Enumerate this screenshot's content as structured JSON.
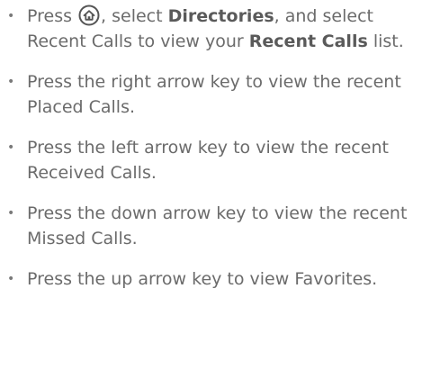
{
  "instructions": [
    {
      "parts": [
        {
          "type": "text",
          "text": "Press "
        },
        {
          "type": "icon",
          "icon": "home-icon"
        },
        {
          "type": "text",
          "text": ", select "
        },
        {
          "type": "bold",
          "text": "Directories"
        },
        {
          "type": "text",
          "text": ", and select Recent Calls to view your "
        },
        {
          "type": "bold",
          "text": "Recent Calls"
        },
        {
          "type": "text",
          "text": " list."
        }
      ]
    },
    {
      "parts": [
        {
          "type": "text",
          "text": "Press the right arrow key to view the recent Placed Calls."
        }
      ]
    },
    {
      "parts": [
        {
          "type": "text",
          "text": "Press the left arrow key to view the recent Received Calls."
        }
      ]
    },
    {
      "parts": [
        {
          "type": "text",
          "text": "Press the down arrow key to view the recent Missed Calls."
        }
      ]
    },
    {
      "parts": [
        {
          "type": "text",
          "text": "Press the up arrow key to view Favorites."
        }
      ]
    }
  ],
  "colors": {
    "text": "#6b6b6b",
    "bold": "#5a5a5a"
  }
}
